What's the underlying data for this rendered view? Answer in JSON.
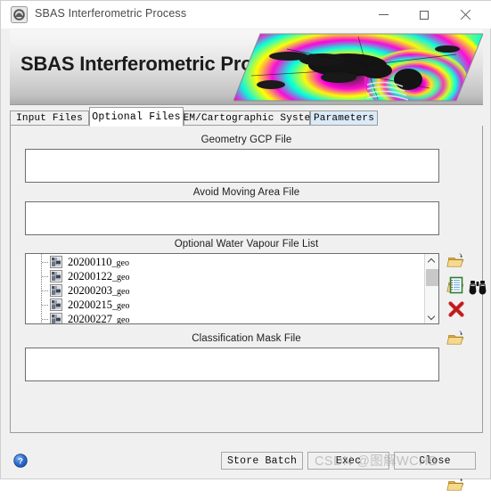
{
  "window": {
    "title": "SBAS Interferometric Process",
    "app_icon": "satellite-icon",
    "minimize_label": "",
    "maximize_label": "",
    "close_label": ""
  },
  "banner": {
    "title": "SBAS Interferometric Process",
    "image_alt": "interferogram-fringe-image"
  },
  "tabs": [
    {
      "label": "Input Files",
      "active": false,
      "highlight": false
    },
    {
      "label": "Optional Files",
      "active": true,
      "highlight": false
    },
    {
      "label": "DEM/Cartographic System",
      "active": false,
      "highlight": false
    },
    {
      "label": "Parameters",
      "active": false,
      "highlight": true
    }
  ],
  "sections": {
    "gcp": {
      "label": "Geometry GCP File",
      "value": "",
      "placeholder": "",
      "buttons": [
        {
          "name": "open-folder-icon",
          "title": "Browse"
        },
        {
          "name": "binoculars-icon",
          "title": "Search"
        }
      ]
    },
    "avoid": {
      "label": "Avoid Moving Area File",
      "value": "",
      "placeholder": "",
      "buttons": [
        {
          "name": "open-folder-icon",
          "title": "Browse"
        }
      ]
    },
    "water_vapour": {
      "label": "Optional Water Vapour File List",
      "items": [
        {
          "name": "20200110",
          "suffix": "_geo"
        },
        {
          "name": "20200122",
          "suffix": "_geo"
        },
        {
          "name": "20200203",
          "suffix": "_geo"
        },
        {
          "name": "20200215",
          "suffix": "_geo"
        },
        {
          "name": "20200227",
          "suffix": "_geo"
        }
      ],
      "buttons": [
        {
          "name": "open-folder-icon",
          "title": "Add files"
        },
        {
          "name": "list-notepad-icon",
          "title": "Edit list"
        },
        {
          "name": "red-x-icon",
          "title": "Remove"
        }
      ]
    },
    "mask": {
      "label": "Classification Mask File",
      "value": "",
      "placeholder": "",
      "buttons": [
        {
          "name": "open-folder-icon",
          "title": "Browse"
        }
      ]
    }
  },
  "footer": {
    "help_label": "?",
    "store_batch_label": "Store Batch",
    "exec_label": "Exec",
    "close_label": "Close"
  },
  "watermark": {
    "text": "CSDN @图解WCHB"
  },
  "colors": {
    "window_bg": "#f0f0f0",
    "tab_active_bg": "#ffffff",
    "tab_highlight_bg": "#dbeaf8",
    "field_bg": "#ffffff",
    "border": "#6e6e6e",
    "help_blue": "#2a63c8",
    "delete_red": "#cc2222",
    "folder_yellow": "#efc75a"
  }
}
